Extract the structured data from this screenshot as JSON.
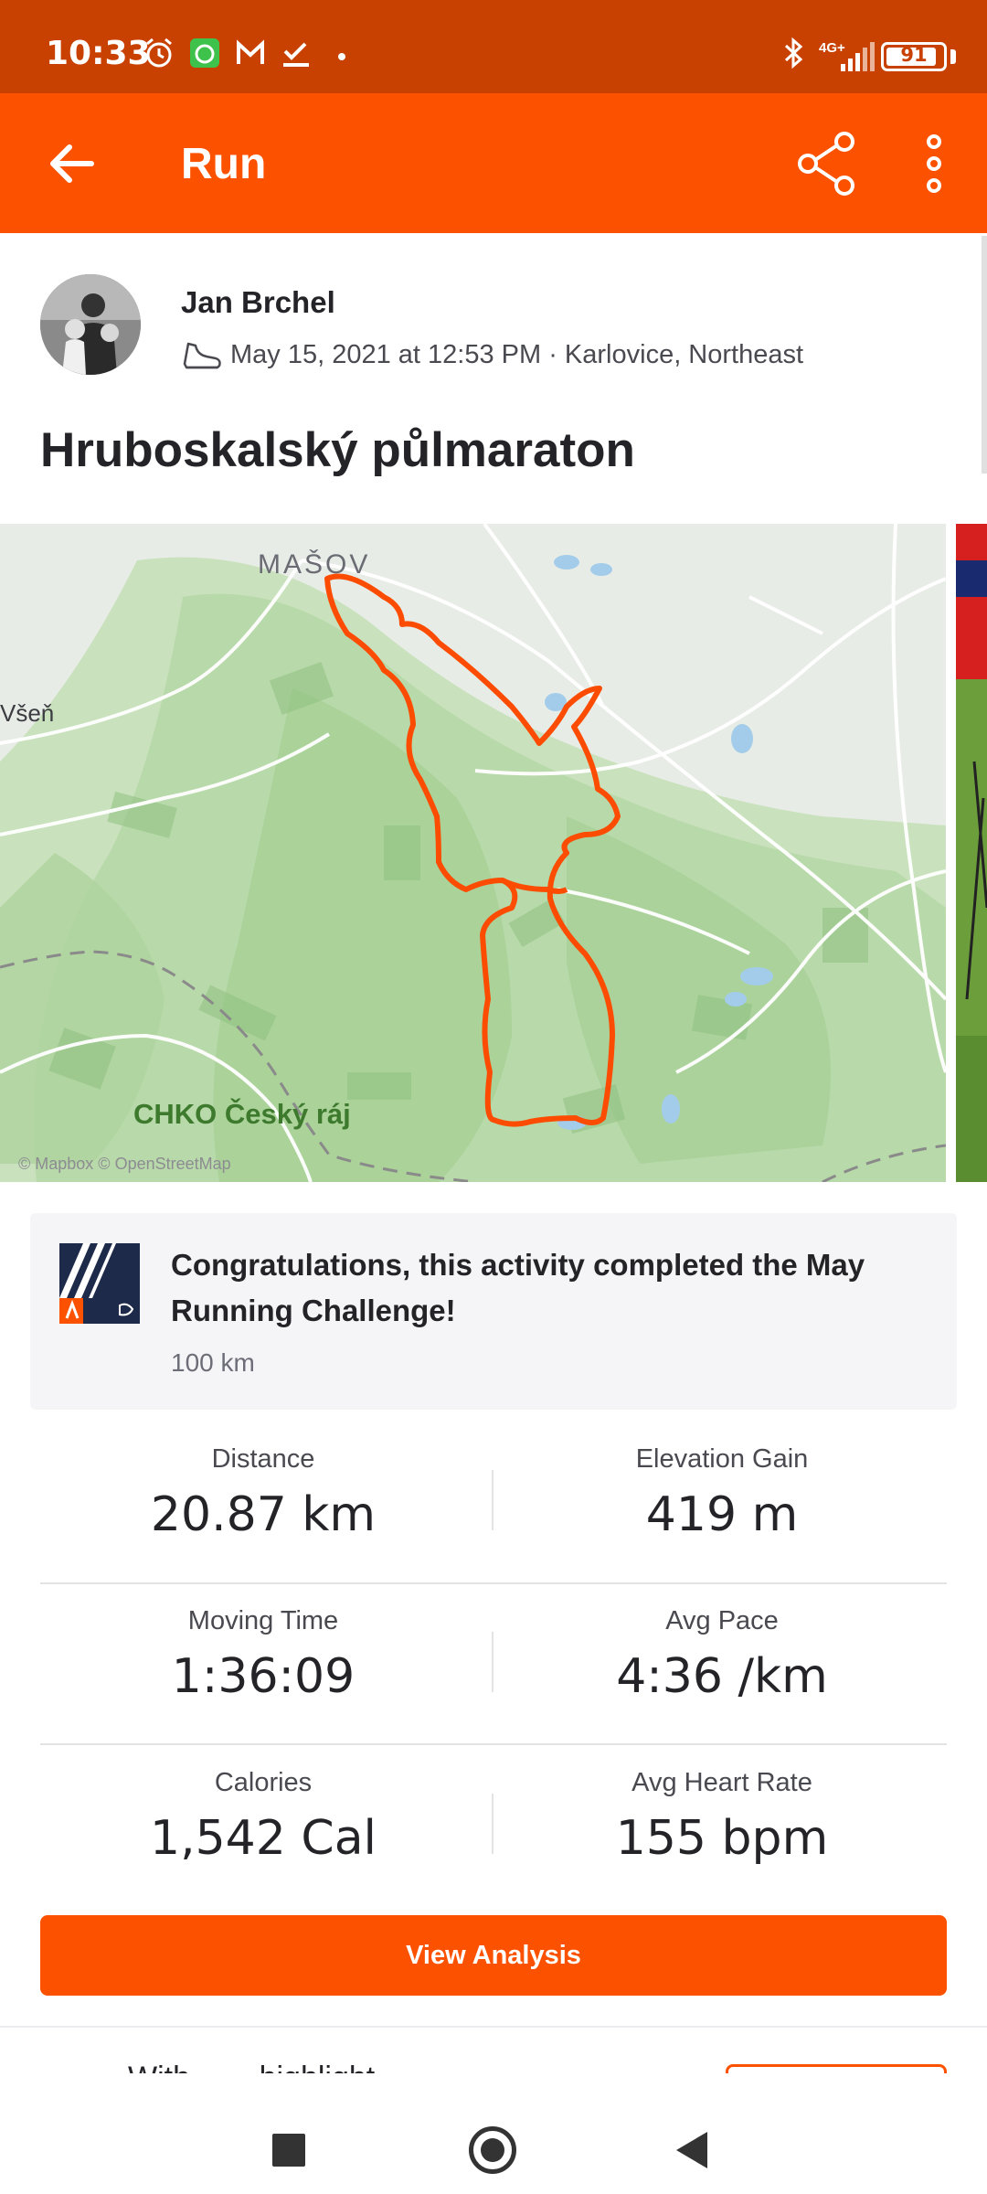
{
  "status_bar": {
    "time": "10:33",
    "network": "4G+",
    "battery": "91",
    "battery_level": 0.91
  },
  "app_bar": {
    "title": "Run",
    "back_icon": "arrow-left-icon",
    "share_icon": "share-icon",
    "more_icon": "more-vertical-icon"
  },
  "activity": {
    "athlete_name": "Jan Brchel",
    "meta": "May 15, 2021 at 12:53 PM · Karlovice, Northeast",
    "sport_icon": "shoe-icon",
    "title": "Hruboskalský půlmaraton"
  },
  "map": {
    "labels": {
      "town": "MAŠOV",
      "west": "Všeň",
      "park": "CHKO Český ráj",
      "attribution": "© Mapbox © OpenStreetMap"
    },
    "route_color": "#fc4c02"
  },
  "challenge": {
    "text": "Congratulations, this activity completed the May Running Challenge!",
    "subtitle": "100 km",
    "badge_icon": "challenge-badge-icon"
  },
  "stats": [
    {
      "label": "Distance",
      "value": "20.87 km"
    },
    {
      "label": "Elevation Gain",
      "value": "419 m"
    },
    {
      "label": "Moving Time",
      "value": "1:36:09"
    },
    {
      "label": "Avg Pace",
      "value": "4:36 /km"
    },
    {
      "label": "Calories",
      "value": "1,542 Cal"
    },
    {
      "label": "Avg Heart Rate",
      "value": "155 bpm"
    }
  ],
  "actions": {
    "view_analysis": "View Analysis",
    "partial_text": "With            ...     ...highlight"
  },
  "colors": {
    "brand": "#fc5200",
    "status_bar": "#c94100"
  }
}
